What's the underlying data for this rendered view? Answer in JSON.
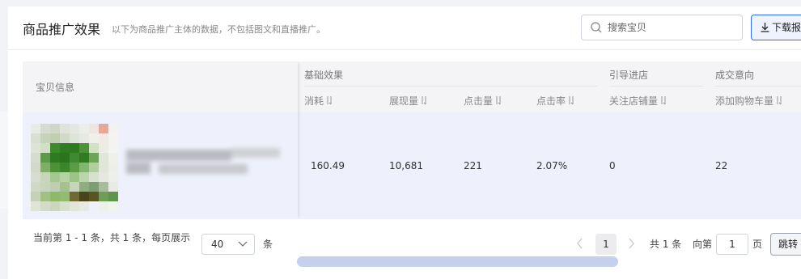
{
  "header": {
    "title": "商品推广效果",
    "subtitle": "以下为商品推广主体的数据，不包括图文和直播推广。",
    "search_placeholder": "搜索宝贝",
    "download_label": "下载报"
  },
  "table": {
    "fixed_header": "宝贝信息",
    "groups": [
      "基础效果",
      "引导进店",
      "成交意向"
    ],
    "columns": [
      "消耗",
      "展现量",
      "点击量",
      "点击率",
      "关注店铺量",
      "添加购物车量"
    ],
    "rows": [
      {
        "values": [
          "160.49",
          "10,681",
          "221",
          "2.07%",
          "0",
          "22"
        ]
      }
    ]
  },
  "pagination": {
    "summary": "当前第 1 - 1 条，共 1 条，每页展示",
    "page_size": "40",
    "page_size_unit": "条",
    "current_page": "1",
    "total": "共 1 条",
    "goto_label": "向第",
    "goto_value": "1",
    "page_unit": "页",
    "jump_label": "跳转"
  },
  "icons": {
    "search": "search-icon",
    "download": "download-icon",
    "sort": "sort-icon",
    "prev": "chevron-left-icon",
    "next": "chevron-right-icon",
    "dropdown": "chevron-down-icon"
  },
  "colors": {
    "accent": "#2c6cf6",
    "row_highlight": "#eef1fb",
    "scrollbar": "#c5cfee"
  }
}
